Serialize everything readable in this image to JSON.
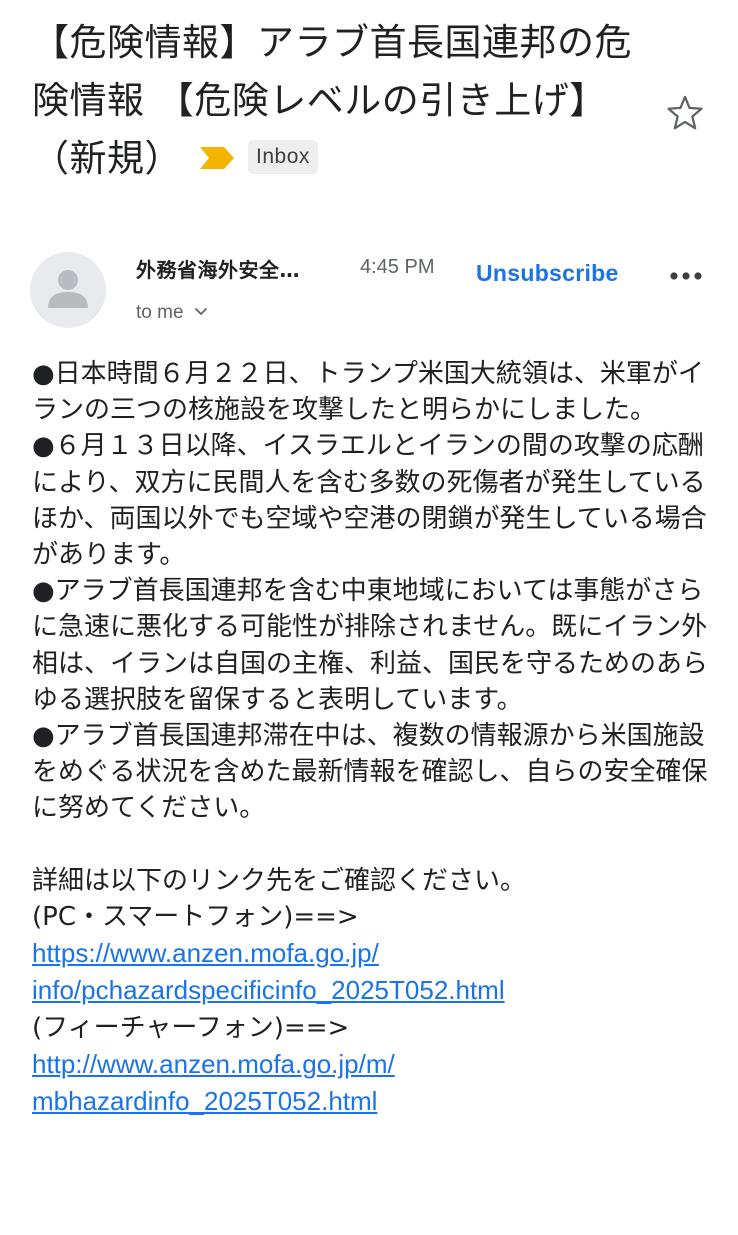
{
  "subject": {
    "text": "【危険情報】アラブ首長国連邦の危険情報 【危険レベルの引き上げ】（新規）",
    "label": "Inbox",
    "importance_marker_color": "#f4b400",
    "star_icon": "star-outline-icon"
  },
  "sender": {
    "name": "外務省海外安全…",
    "time": "4:45 PM",
    "recipient": "to me",
    "unsubscribe_label": "Unsubscribe",
    "avatar_icon": "person-icon",
    "more_icon": "more-horizontal-icon",
    "expand_icon": "chevron-down-icon"
  },
  "body": {
    "paragraphs": [
      "●日本時間６月２２日、トランプ米国大統領は、米軍がイランの三つの核施設を攻撃したと明らかにしました。",
      "●６月１３日以降、イスラエルとイランの間の攻撃の応酬により、双方に民間人を含む多数の死傷者が発生しているほか、両国以外でも空域や空港の閉鎖が発生している場合があります。",
      "●アラブ首長国連邦を含む中東地域においては事態がさらに急速に悪化する可能性が排除されません。既にイラン外相は、イランは自国の主権、利益、国民を守るためのあらゆる選択肢を留保すると表明しています。",
      "●アラブ首長国連邦滞在中は、複数の情報源から米国施設をめぐる状況を含めた最新情報を確認し、自らの安全確保に努めてください。"
    ],
    "details_intro": "詳細は以下のリンク先をご確認ください。",
    "pc_label": "(PC・スマートフォン)==>",
    "pc_link_line1": "https://www.anzen.mofa.go.jp/",
    "pc_link_line2": "info/pchazardspecificinfo_2025T052.html",
    "feature_phone_label": "(フィーチャーフォン)==>",
    "fp_link_line1": "http://www.anzen.mofa.go.jp/m/",
    "fp_link_line2": "mbhazardinfo_2025T052.html"
  },
  "colors": {
    "link": "#1a73e8",
    "text": "#202124",
    "secondary_text": "#5f6368",
    "chip_bg": "#eeeeee"
  }
}
